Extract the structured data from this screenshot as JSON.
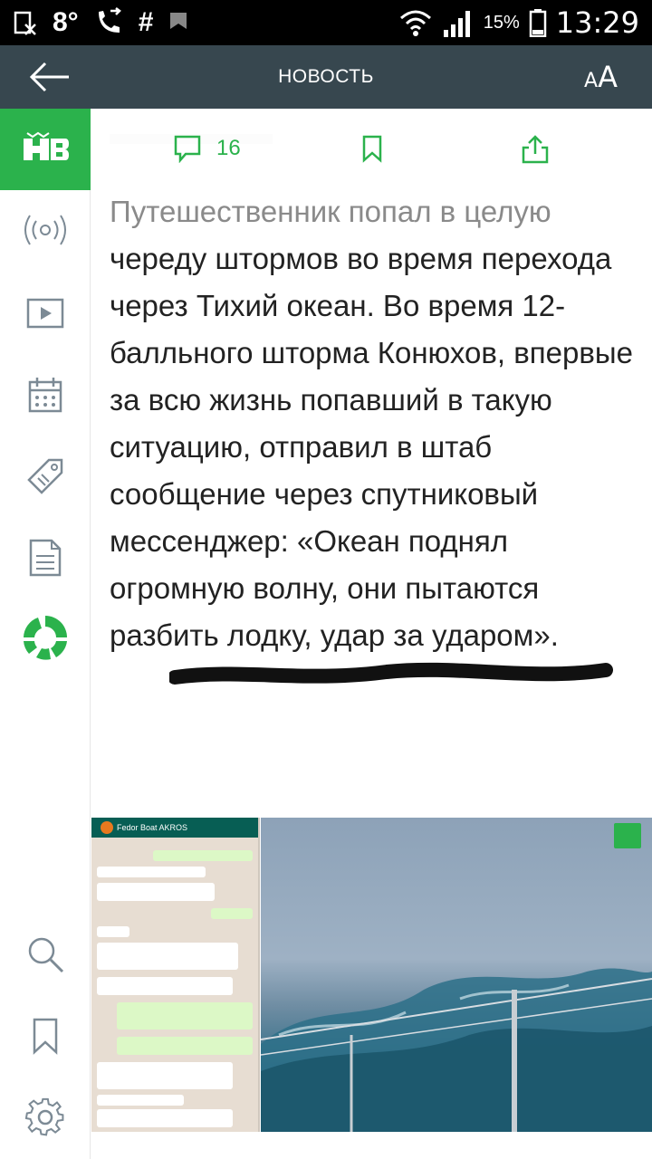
{
  "status_bar": {
    "temperature": "8°",
    "hash": "#",
    "battery_percent": "15%",
    "time": "13:29"
  },
  "app_bar": {
    "title": "НОВОСТЬ",
    "font_size_label_small": "A",
    "font_size_label_large": "A"
  },
  "article": {
    "comment_count": "16",
    "text_first_line": "Путешественник попал в целую",
    "text_rest": "череду штормов во время перехода через Тихий океан. Во время 12-балльного шторма Конюхов, впервые за всю жизнь попавший в такую ситуацию, отправил в штаб сообщение через спутниковый мессенджер: «Океан поднял огромную волну, они пытаются разбить лодку, удар за ударом»."
  },
  "photo": {
    "chat_title": "Fedor Boat AKROS"
  },
  "colors": {
    "accent": "#2bb24c",
    "app_bar": "#37474f",
    "status_bar": "#000000"
  },
  "sidebar": {
    "icons": [
      "ntv-logo-icon",
      "live-radio-icon",
      "video-play-icon",
      "calendar-icon",
      "tag-icon",
      "document-icon",
      "ntv-25-logo-icon",
      "search-icon",
      "bookmark-icon",
      "settings-icon"
    ]
  }
}
